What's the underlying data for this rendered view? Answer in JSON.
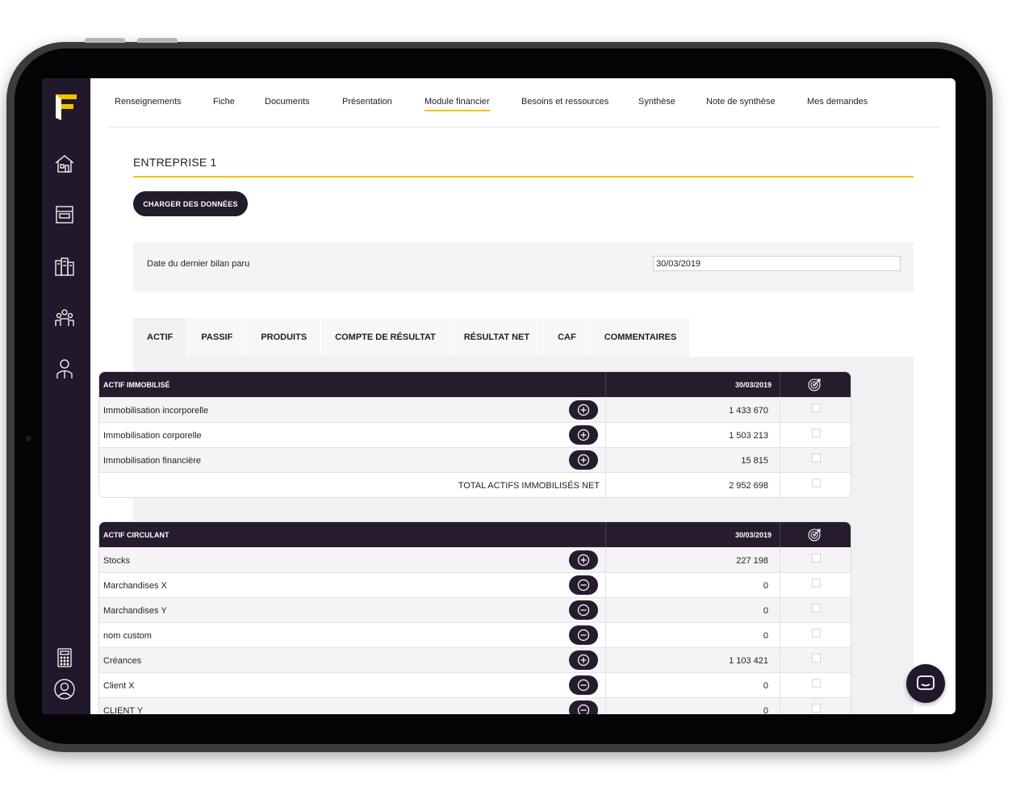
{
  "nav": {
    "items": [
      {
        "label": "Renseignements"
      },
      {
        "label": "Fiche"
      },
      {
        "label": "Documents"
      },
      {
        "label": "Présentation"
      },
      {
        "label": "Module financier",
        "active": true
      },
      {
        "label": "Besoins et ressources"
      },
      {
        "label": "Synthèse"
      },
      {
        "label": "Note de synthèse"
      },
      {
        "label": "Mes demandes"
      }
    ]
  },
  "sidebar": {
    "icons": [
      "home-icon",
      "archive-box-icon",
      "buildings-icon",
      "team-icon",
      "advisor-icon",
      "calculator-icon",
      "user-icon"
    ]
  },
  "page": {
    "title": "ENTREPRISE 1",
    "load_button": "CHARGER DES DONNÉES"
  },
  "balance": {
    "date_label": "Date du dernier bilan paru",
    "date_value": "30/03/2019"
  },
  "tabs": [
    "ACTIF",
    "PASSIF",
    "PRODUITS",
    "COMPTE DE RÉSULTAT",
    "RÉSULTAT NET",
    "CAF",
    "COMMENTAIRES"
  ],
  "tables": [
    {
      "title": "ACTIF IMMOBILISÉ",
      "date": "30/03/2019",
      "rows": [
        {
          "label": "Immobilisation incorporelle",
          "value": "1 433 670",
          "action": "plus"
        },
        {
          "label": "Immobilisation corporelle",
          "value": "1 503 213",
          "action": "plus"
        },
        {
          "label": "Immobilisation financière",
          "value": "15 815",
          "action": "plus"
        }
      ],
      "total": {
        "label": "TOTAL ACTIFS IMMOBILISÉS NET",
        "value": "2 952 698"
      }
    },
    {
      "title": "ACTIF CIRCULANT",
      "date": "30/03/2019",
      "rows": [
        {
          "label": "Stocks",
          "value": "227 198",
          "action": "plus"
        },
        {
          "label": "Marchandises X",
          "value": "0",
          "action": "minus"
        },
        {
          "label": "Marchandises Y",
          "value": "0",
          "action": "minus"
        },
        {
          "label": "nom custom",
          "value": "0",
          "action": "minus"
        },
        {
          "label": "Créances",
          "value": "1 103 421",
          "action": "plus"
        },
        {
          "label": "Client X",
          "value": "0",
          "action": "minus"
        },
        {
          "label": "CLIENT Y",
          "value": "0",
          "action": "minus"
        }
      ]
    }
  ],
  "colors": {
    "accent": "#f2c200",
    "dark": "#22182c"
  }
}
